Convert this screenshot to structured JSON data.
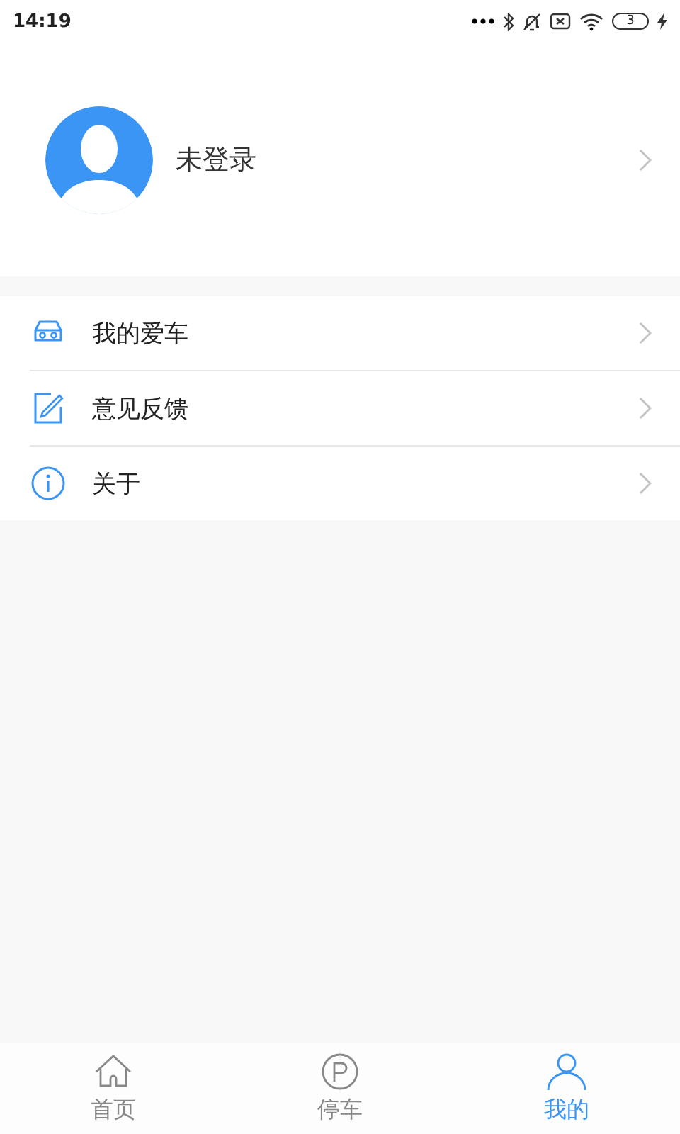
{
  "status_bar": {
    "time": "14:19",
    "battery": "3"
  },
  "profile": {
    "name": "未登录"
  },
  "menu": [
    {
      "kind": "car",
      "label": "我的爱车"
    },
    {
      "kind": "edit",
      "label": "意见反馈"
    },
    {
      "kind": "info",
      "label": "关于"
    }
  ],
  "tabs": [
    {
      "kind": "home",
      "label": "首页",
      "selected": false
    },
    {
      "kind": "parking",
      "label": "停车",
      "selected": false
    },
    {
      "kind": "person",
      "label": "我的",
      "selected": true
    }
  ]
}
